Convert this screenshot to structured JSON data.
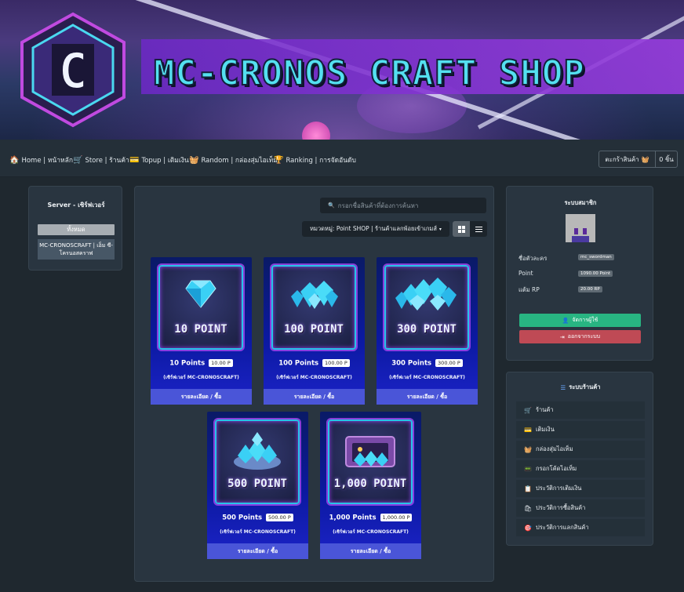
{
  "banner": {
    "logo_letter": "C",
    "title": "MC-CRONOS CRAFT SHOP"
  },
  "nav": [
    {
      "icon": "🏠",
      "label": "Home | หน้าหลัก"
    },
    {
      "icon": "🛒",
      "label": "Store | ร้านค้า"
    },
    {
      "icon": "💳",
      "label": "Topup | เติมเงิน"
    },
    {
      "icon": "🧺",
      "label": "Random | กล่องสุ่มไอเท็ม"
    },
    {
      "icon": "🏆",
      "label": "Ranking | การจัดอันดับ"
    }
  ],
  "cart": {
    "label": "ตะกร้าสินค้า",
    "icon": "🧺",
    "count": "0 ชิ้น"
  },
  "server_panel": {
    "title": "Server - เซิร์ฟเวอร์",
    "all": "ทั้งหมด",
    "server": "MC-CRONOSCRAFT | เอ็ม ซี-โครนอสคราฟ"
  },
  "main": {
    "search_placeholder": "กรอกชื่อสินค้าที่ต้องการค้นหา",
    "category": "หมวดหมู่: Point SHOP | ร้านค้าแลกพ้อยเข้าเกมส์",
    "products": [
      {
        "img_text": "10 POINT",
        "name": "10 Points",
        "price": "10.00 P",
        "server": "(เซิร์ฟเวอร์ MC-CRONOSCRAFT)",
        "button": "รายละเอียด / ซื้อ"
      },
      {
        "img_text": "100 POINT",
        "name": "100 Points",
        "price": "100.00 P",
        "server": "(เซิร์ฟเวอร์ MC-CRONOSCRAFT)",
        "button": "รายละเอียด / ซื้อ"
      },
      {
        "img_text": "300 POINT",
        "name": "300 Points",
        "price": "300.00 P",
        "server": "(เซิร์ฟเวอร์ MC-CRONOSCRAFT)",
        "button": "รายละเอียด / ซื้อ"
      },
      {
        "img_text": "500 POINT",
        "name": "500 Points",
        "price": "500.00 P",
        "server": "(เซิร์ฟเวอร์ MC-CRONOSCRAFT)",
        "button": "รายละเอียด / ซื้อ"
      },
      {
        "img_text": "1,000 POINT",
        "name": "1,000 Points",
        "price": "1,000.00 P",
        "server": "(เซิร์ฟเวอร์ MC-CRONOSCRAFT)",
        "button": "รายละเอียด / ซื้อ"
      }
    ]
  },
  "member": {
    "title": "ระบบสมาชิก",
    "username_label": "ชื่อตัวละคร",
    "username": "mc_swordman",
    "point_label": "Point",
    "point": "1090.00 Point",
    "rp_label": "แต้ม RP",
    "rp": "20.00 RP",
    "manage": "จัดการผู้ใช้",
    "logout": "ออกจากระบบ"
  },
  "shop_menu": {
    "title": "ระบบร้านค้า",
    "items": [
      {
        "icon": "🛒",
        "label": "ร้านค้า"
      },
      {
        "icon": "💳",
        "label": "เติมเงิน"
      },
      {
        "icon": "🧺",
        "label": "กล่องสุ่มไอเท็ม"
      },
      {
        "icon": "📟",
        "label": "กรอกโค้ดไอเท็ม"
      },
      {
        "icon": "📋",
        "label": "ประวัติการเติมเงิน"
      },
      {
        "icon": "🛍",
        "label": "ประวัติการซื้อสินค้า"
      },
      {
        "icon": "🎯",
        "label": "ประวัติการแลกสินค้า"
      }
    ]
  }
}
